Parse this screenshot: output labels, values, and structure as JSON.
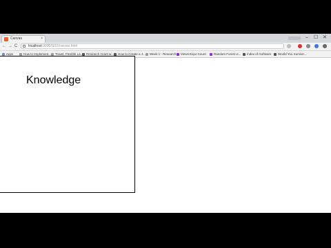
{
  "browser": {
    "tab": {
      "title": "Canvas",
      "close": "×",
      "favicon_color": "#e8622a"
    },
    "window_controls": {
      "minimize": "–",
      "maximize": "☐",
      "close": "✕"
    },
    "nav": {
      "back": "←",
      "forward": "→",
      "reload": "C"
    },
    "address": {
      "host": "localhost",
      "path": ":9000/G02/canvas.html"
    },
    "bookmarks": [
      {
        "label": "Apps",
        "color": "#6a8fd8"
      },
      {
        "label": "How to Implement...",
        "color": "#999999"
      },
      {
        "label": "Travel, Flexible La...",
        "color": "#999999"
      },
      {
        "label": "Research Grant w...",
        "color": "#555555"
      },
      {
        "label": "How to Create a J...",
        "color": "#555555"
      },
      {
        "label": "Week 1 - Research...",
        "color": "#999999"
      },
      {
        "label": "Views Expo Count",
        "color": "#8a2be2"
      },
      {
        "label": "Random Forest vi...",
        "color": "#8a2be2"
      },
      {
        "label": "Index of /software",
        "color": "#555555"
      },
      {
        "label": "Would You Survive...",
        "color": "#555555"
      }
    ],
    "toolbar_icons": [
      {
        "name": "star-icon",
        "color": "#bbbbbb"
      },
      {
        "name": "extension-red-icon",
        "color": "#d0342c"
      },
      {
        "name": "extension-gray-icon",
        "color": "#888888"
      },
      {
        "name": "extension-blue-icon",
        "color": "#3b78e7"
      },
      {
        "name": "menu-icon",
        "color": "#666666"
      }
    ]
  },
  "canvas": {
    "heading": "Knowledge"
  }
}
